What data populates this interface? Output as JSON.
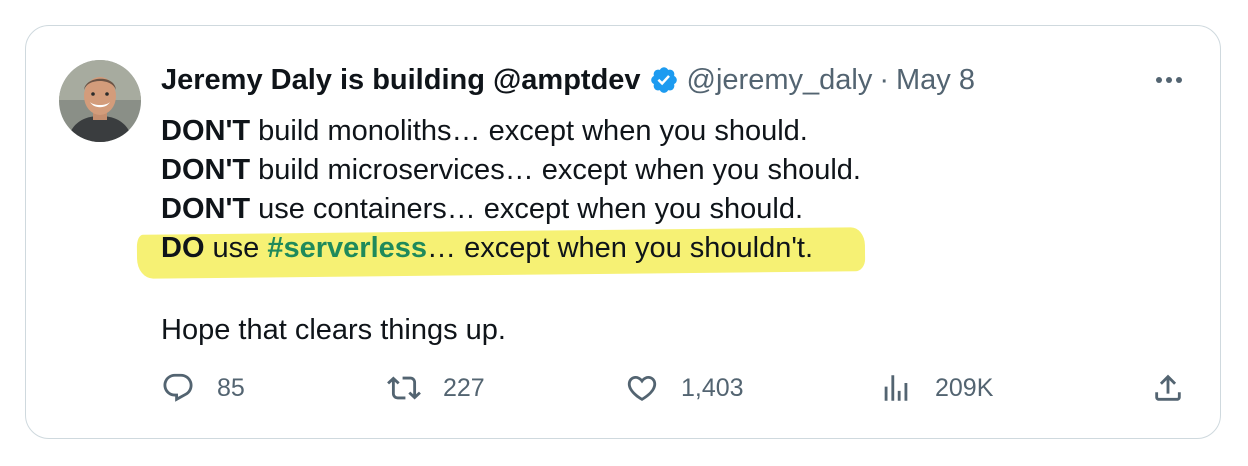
{
  "author": {
    "display_name": "Jeremy Daly is building @amptdev",
    "handle": "@jeremy_daly",
    "separator": "·",
    "date": "May 8",
    "verified": true
  },
  "tweet": {
    "lines": [
      {
        "bold": "DON'T",
        "rest": " build monoliths… except when you should."
      },
      {
        "bold": "DON'T",
        "rest": " build microservices… except when you should."
      },
      {
        "bold": "DON'T",
        "rest": " use containers… except when you should."
      }
    ],
    "highlight_line": {
      "bold": "DO",
      "pre": " use ",
      "hashtag": "#serverless",
      "post": "… except when you shouldn't."
    },
    "closing": "Hope that clears things up."
  },
  "actions": {
    "reply": {
      "icon": "reply-icon",
      "count": "85"
    },
    "retweet": {
      "icon": "retweet-icon",
      "count": "227"
    },
    "like": {
      "icon": "heart-icon",
      "count": "1,403"
    },
    "views": {
      "icon": "views-icon",
      "count": "209K"
    },
    "share": {
      "icon": "share-icon"
    }
  },
  "colors": {
    "text": "#0f1419",
    "secondary": "#536471",
    "verified": "#1d9bf0",
    "highlight": "#f6f174",
    "hashtag": "#1f8a5b",
    "border": "#cfd9de"
  }
}
